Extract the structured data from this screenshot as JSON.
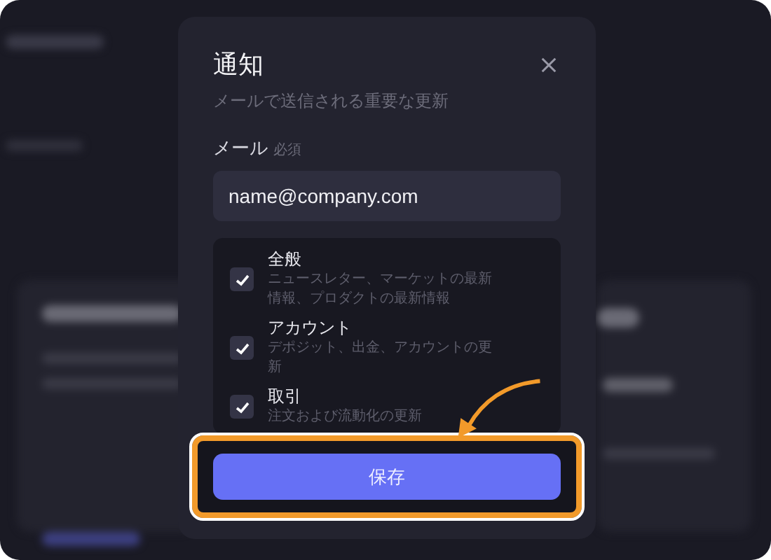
{
  "dialog": {
    "title": "通知",
    "subtitle": "メールで送信される重要な更新",
    "email": {
      "label": "メール",
      "required_note": "必須",
      "value": "name@company.com"
    },
    "options": [
      {
        "title": "全般",
        "description": "ニュースレター、マーケットの最新情報、プロダクトの最新情報",
        "checked": true
      },
      {
        "title": "アカウント",
        "description": "デポジット、出金、アカウントの更新",
        "checked": true
      },
      {
        "title": "取引",
        "description": "注文および流動化の更新",
        "checked": true
      }
    ],
    "save_button": "保存"
  }
}
